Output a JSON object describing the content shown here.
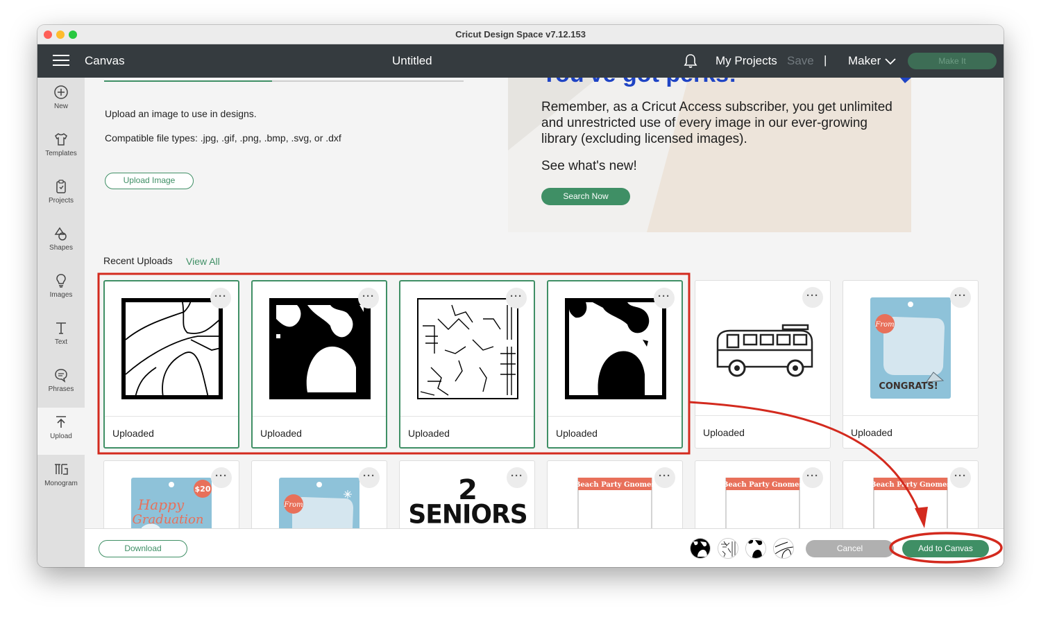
{
  "window": {
    "title": "Cricut Design Space  v7.12.153"
  },
  "appbar": {
    "section": "Canvas",
    "document_title": "Untitled",
    "my_projects": "My Projects",
    "save": "Save",
    "separator": "|",
    "machine": "Maker",
    "make_it": "Make It"
  },
  "sidebar": {
    "items": [
      {
        "label": "New",
        "icon": "plus-circle-icon"
      },
      {
        "label": "Templates",
        "icon": "shirt-icon"
      },
      {
        "label": "Projects",
        "icon": "projects-icon"
      },
      {
        "label": "Shapes",
        "icon": "shapes-icon"
      },
      {
        "label": "Images",
        "icon": "lightbulb-icon"
      },
      {
        "label": "Text",
        "icon": "text-icon"
      },
      {
        "label": "Phrases",
        "icon": "speech-bubble-icon"
      },
      {
        "label": "Upload",
        "icon": "upload-icon"
      },
      {
        "label": "Monogram",
        "icon": "monogram-icon"
      }
    ],
    "active": "Upload"
  },
  "upload": {
    "description": "Upload an image to use in designs.",
    "compatible": "Compatible file types: .jpg, .gif, .png, .bmp, .svg, or .dxf",
    "button": "Upload Image"
  },
  "promo": {
    "headline": "You've got perks!",
    "text": "Remember, as a Cricut Access subscriber, you get unlimited and unrestricted use of every image in our ever-growing library (excluding licensed images).",
    "see_new": "See what's new!",
    "button": "Search Now"
  },
  "recent": {
    "label": "Recent Uploads",
    "view_all": "View All",
    "cards": [
      {
        "label": "Uploaded",
        "selected": true,
        "kind": "map-lines"
      },
      {
        "label": "Uploaded",
        "selected": true,
        "kind": "silhouette"
      },
      {
        "label": "Uploaded",
        "selected": true,
        "kind": "street-map"
      },
      {
        "label": "Uploaded",
        "selected": true,
        "kind": "silhouette"
      },
      {
        "label": "Uploaded",
        "selected": false,
        "kind": "van"
      },
      {
        "label": "Uploaded",
        "selected": false,
        "kind": "congrats-tag"
      }
    ],
    "row2": [
      {
        "kind": "graduation-tag",
        "text1": "Happy",
        "text2": "Graduation",
        "price": "$20"
      },
      {
        "kind": "blue-tag",
        "text1": "From"
      },
      {
        "kind": "seniors",
        "text1": "2",
        "text2": "SENIORS"
      },
      {
        "kind": "gnome-tag",
        "text1": "Beach Party Gnomes"
      },
      {
        "kind": "gnome-tag",
        "text1": "Beach Party Gnomes"
      },
      {
        "kind": "gnome-tag",
        "text1": "Beach Party Gnomes"
      }
    ],
    "tag_texts": {
      "from": "From",
      "congrats": "CONGRATS!"
    }
  },
  "bottom": {
    "download": "Download",
    "cancel": "Cancel",
    "add_to_canvas": "Add to Canvas",
    "selected_count": 4
  },
  "colors": {
    "accent": "#3f8f65",
    "appbar": "#353b3f",
    "highlight": "#d32a1e",
    "promo_blue": "#1f44c4"
  }
}
